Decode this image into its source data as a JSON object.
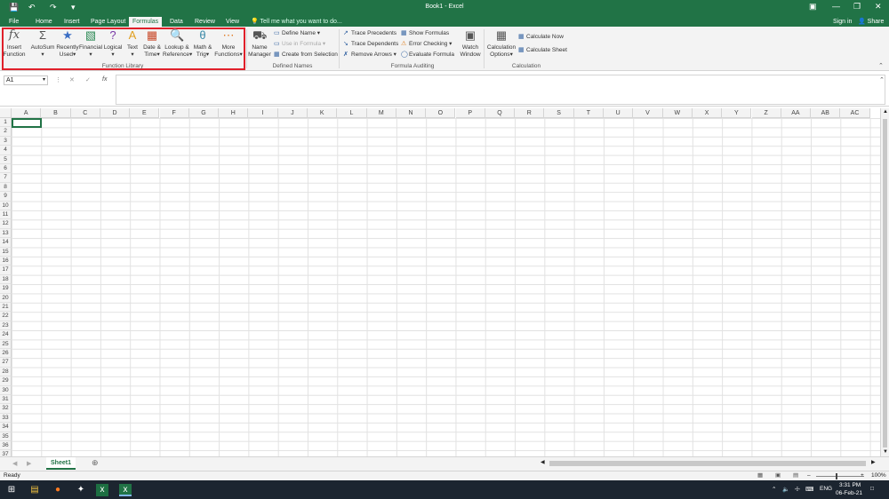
{
  "window": {
    "title": "Book1 - Excel",
    "qa_save_icon": "save-icon",
    "undo_icon": "undo-icon",
    "redo_icon": "redo-icon"
  },
  "tabs": [
    "File",
    "Home",
    "Insert",
    "Page Layout",
    "Formulas",
    "Data",
    "Review",
    "View"
  ],
  "active_tab": "Formulas",
  "tellme": "Tell me what you want to do...",
  "signin": "Sign in",
  "share": "Share",
  "ribbon": {
    "function_library": {
      "label": "Function Library",
      "buttons": [
        {
          "l1": "Insert",
          "l2": "Function",
          "icon": "fx-icon"
        },
        {
          "l1": "AutoSum",
          "l2": "",
          "icon": "sigma-icon"
        },
        {
          "l1": "Recently",
          "l2": "Used",
          "icon": "star-book-icon"
        },
        {
          "l1": "Financial",
          "l2": "",
          "icon": "financial-book-icon"
        },
        {
          "l1": "Logical",
          "l2": "",
          "icon": "question-book-icon"
        },
        {
          "l1": "Text",
          "l2": "",
          "icon": "text-book-icon"
        },
        {
          "l1": "Date &",
          "l2": "Time",
          "icon": "date-book-icon"
        },
        {
          "l1": "Lookup &",
          "l2": "Reference",
          "icon": "lookup-book-icon"
        },
        {
          "l1": "Math &",
          "l2": "Trig",
          "icon": "math-book-icon"
        },
        {
          "l1": "More",
          "l2": "Functions",
          "icon": "more-book-icon"
        }
      ]
    },
    "defined_names": {
      "label": "Defined Names",
      "name_manager_l1": "Name",
      "name_manager_l2": "Manager",
      "define_name": "Define Name",
      "use_in_formula": "Use in Formula",
      "create_from_selection": "Create from Selection"
    },
    "formula_auditing": {
      "label": "Formula Auditing",
      "trace_precedents": "Trace Precedents",
      "trace_dependents": "Trace Dependents",
      "remove_arrows": "Remove Arrows",
      "show_formulas": "Show Formulas",
      "error_checking": "Error Checking",
      "evaluate_formula": "Evaluate Formula",
      "watch_l1": "Watch",
      "watch_l2": "Window"
    },
    "calculation": {
      "label": "Calculation",
      "options_l1": "Calculation",
      "options_l2": "Options",
      "calc_now": "Calculate Now",
      "calc_sheet": "Calculate Sheet"
    }
  },
  "formula_bar": {
    "name_box": "A1",
    "fx": "fx"
  },
  "columns": [
    "A",
    "B",
    "C",
    "D",
    "E",
    "F",
    "G",
    "H",
    "I",
    "J",
    "K",
    "L",
    "M",
    "N",
    "O",
    "P",
    "Q",
    "R",
    "S",
    "T",
    "U",
    "V",
    "W",
    "X",
    "Y",
    "Z",
    "AA",
    "AB",
    "AC"
  ],
  "rows": [
    "1",
    "2",
    "3",
    "4",
    "5",
    "6",
    "7",
    "8",
    "9",
    "10",
    "11",
    "12",
    "13",
    "14",
    "15",
    "16",
    "17",
    "18",
    "19",
    "20",
    "21",
    "22",
    "23",
    "24",
    "25",
    "26",
    "27",
    "28",
    "29",
    "30",
    "31",
    "32",
    "33",
    "34",
    "35",
    "36",
    "37"
  ],
  "sheet_tab": "Sheet1",
  "status": {
    "ready": "Ready",
    "zoom": "100%"
  },
  "taskbar": {
    "lang": "ENG",
    "time": "3:31 PM",
    "date": "06-Feb-21"
  }
}
